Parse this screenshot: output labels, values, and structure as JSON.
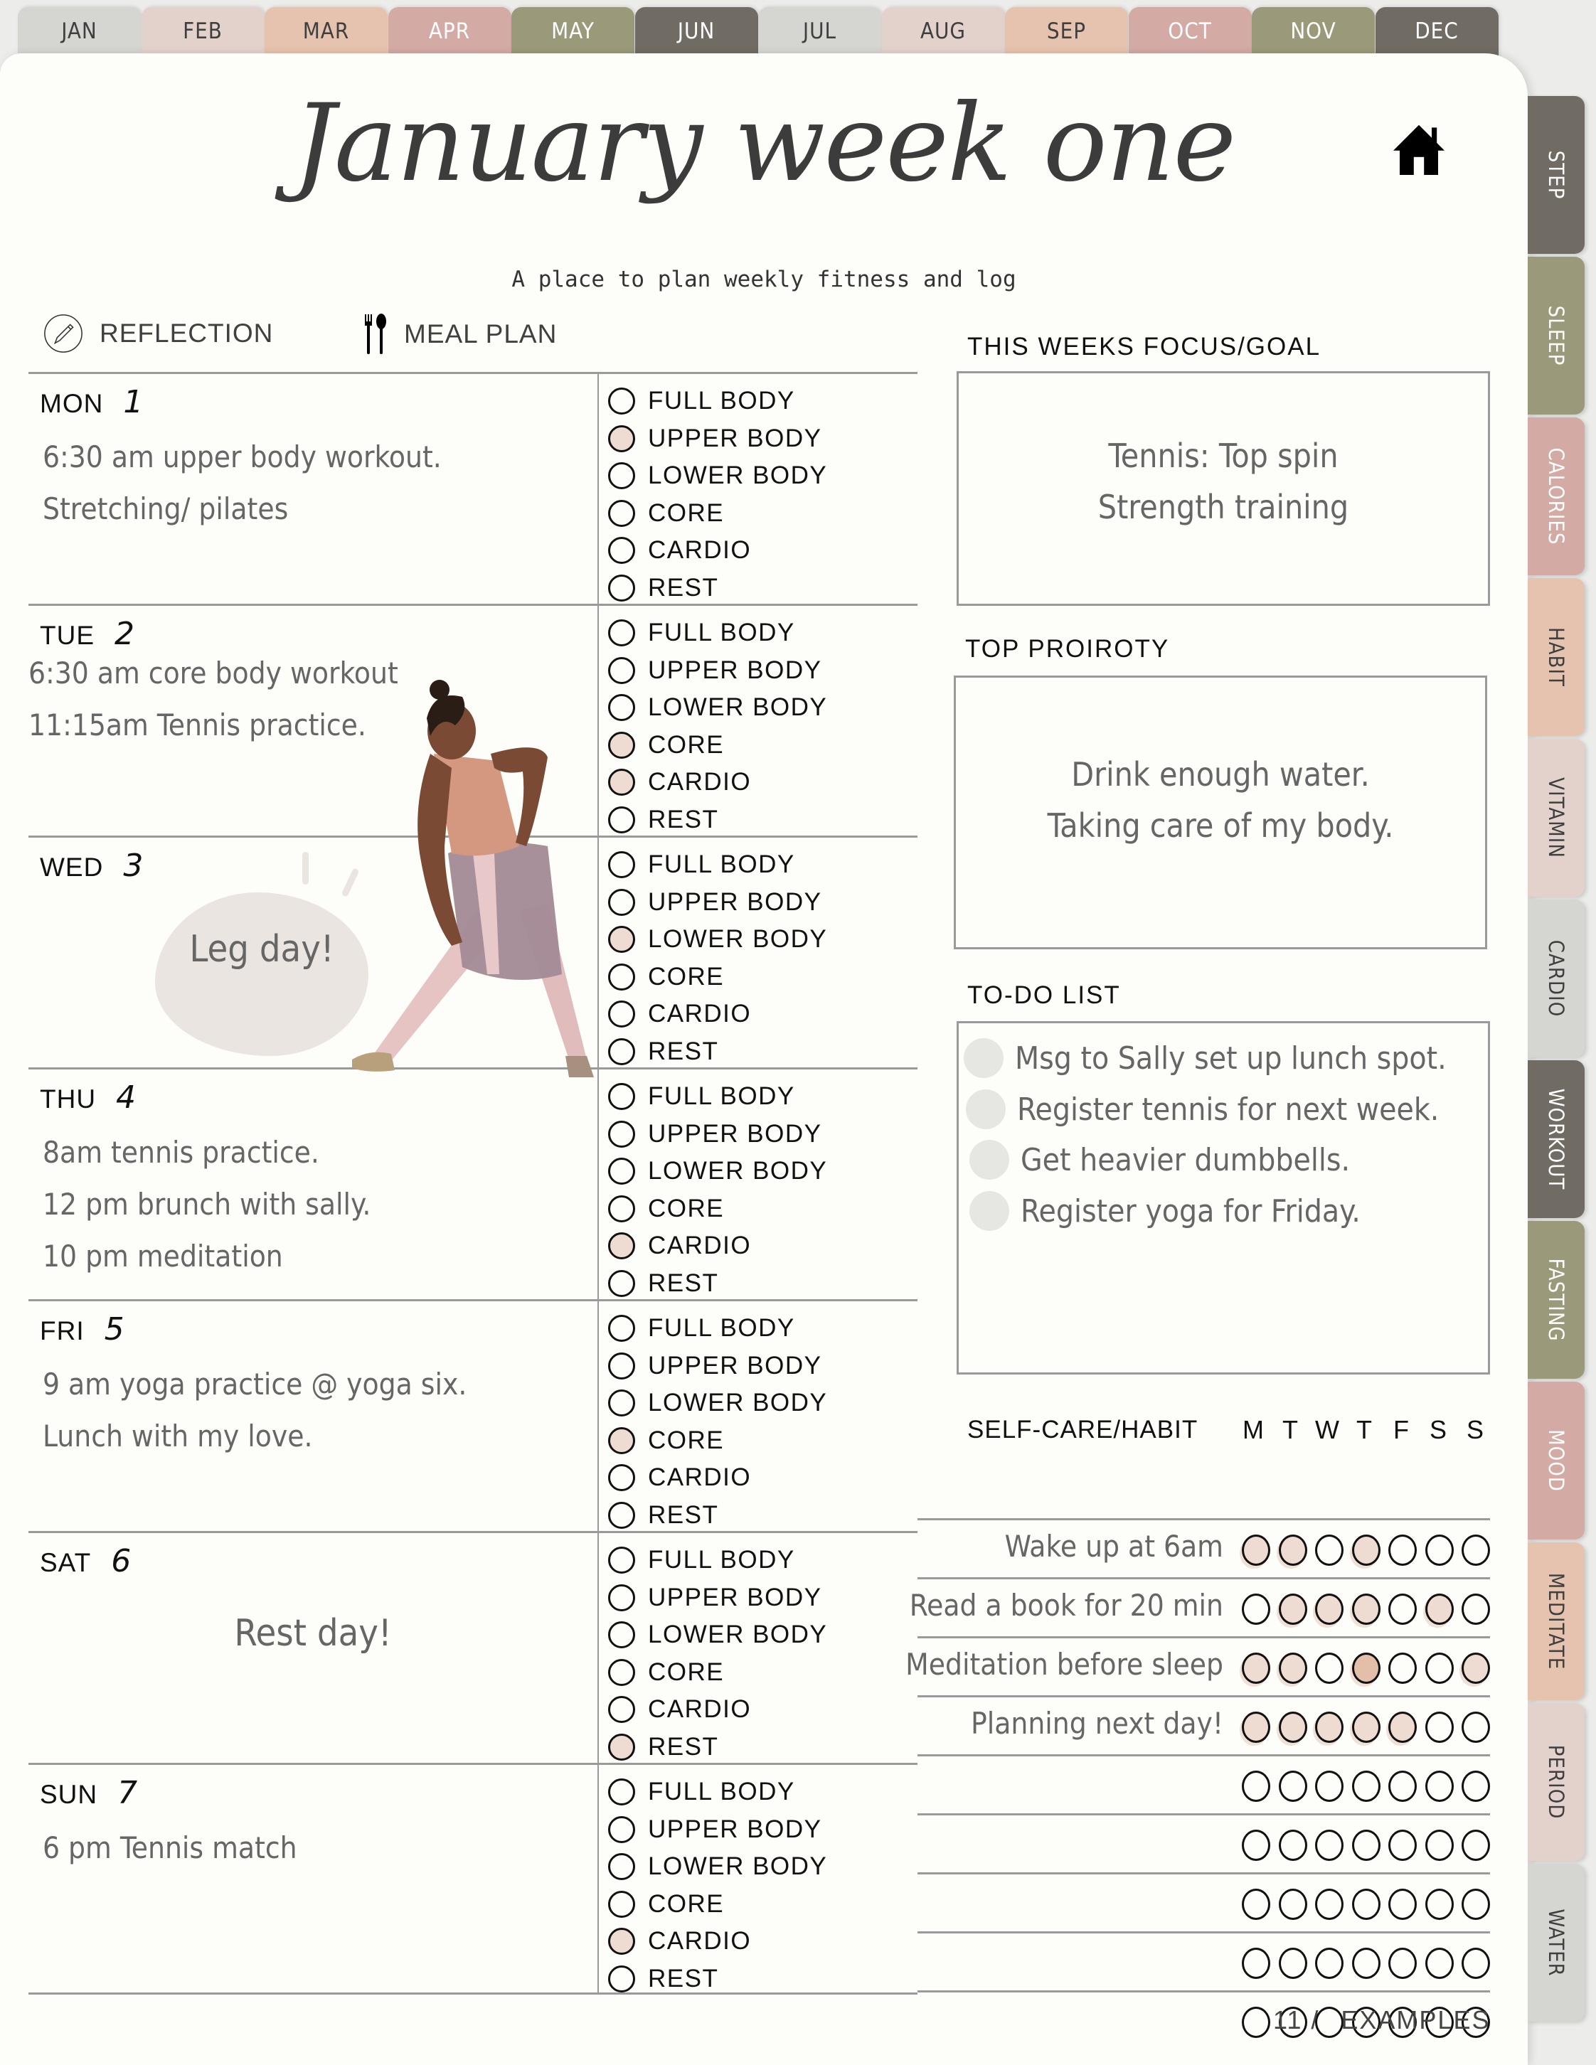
{
  "month_tabs": [
    {
      "label": "JAN",
      "style": "t-grey"
    },
    {
      "label": "FEB",
      "style": "t-blush"
    },
    {
      "label": "MAR",
      "style": "t-peach"
    },
    {
      "label": "APR",
      "style": "t-rose"
    },
    {
      "label": "MAY",
      "style": "t-olive"
    },
    {
      "label": "JUN",
      "style": "t-dark"
    },
    {
      "label": "JUL",
      "style": "t-grey"
    },
    {
      "label": "AUG",
      "style": "t-blush"
    },
    {
      "label": "SEP",
      "style": "t-peach"
    },
    {
      "label": "OCT",
      "style": "t-rose"
    },
    {
      "label": "NOV",
      "style": "t-olive"
    },
    {
      "label": "DEC",
      "style": "t-dark"
    }
  ],
  "side_tabs": [
    {
      "label": "STEP",
      "style": "t-dark"
    },
    {
      "label": "SLEEP",
      "style": "t-olive"
    },
    {
      "label": "CALORIES",
      "style": "t-rose"
    },
    {
      "label": "HABIT",
      "style": "t-peach"
    },
    {
      "label": "VITAMIN",
      "style": "t-blush"
    },
    {
      "label": "CARDIO",
      "style": "t-grey"
    },
    {
      "label": "WORKOUT",
      "style": "t-dark"
    },
    {
      "label": "FASTING",
      "style": "t-olive"
    },
    {
      "label": "MOOD",
      "style": "t-rose"
    },
    {
      "label": "MEDITATE",
      "style": "t-peach"
    },
    {
      "label": "PERIOD",
      "style": "t-blush"
    },
    {
      "label": "WATER",
      "style": "t-grey"
    }
  ],
  "header": {
    "title": "January week one",
    "subtitle": "A place to plan weekly fitness and log",
    "home_icon": "home-icon"
  },
  "quick_links": {
    "reflection": "REFLECTION",
    "meal_plan": "MEAL PLAN"
  },
  "workout_options": [
    "FULL BODY",
    "UPPER BODY",
    "LOWER BODY",
    "CORE",
    "CARDIO",
    "REST"
  ],
  "days": [
    {
      "name": "MON",
      "num": "1",
      "notes": [
        "6:30 am upper body workout.",
        "Stretching/ pilates"
      ],
      "centered": false,
      "checked": [
        "UPPER BODY"
      ]
    },
    {
      "name": "TUE",
      "num": "2",
      "notes": [
        "6:30 am core body workout",
        "11:15am Tennis practice."
      ],
      "centered": false,
      "checked": [
        "CORE",
        "CARDIO"
      ]
    },
    {
      "name": "WED",
      "num": "3",
      "notes": [],
      "centered": false,
      "checked": [
        "LOWER BODY"
      ]
    },
    {
      "name": "THU",
      "num": "4",
      "notes": [
        "8am tennis practice.",
        "12 pm brunch with sally.",
        "10 pm meditation"
      ],
      "centered": false,
      "checked": [
        "CARDIO"
      ]
    },
    {
      "name": "FRI",
      "num": "5",
      "notes": [
        "9 am yoga practice @ yoga six.",
        "Lunch with my love."
      ],
      "centered": false,
      "checked": [
        "CORE"
      ]
    },
    {
      "name": "SAT",
      "num": "6",
      "notes": [
        "Rest day!"
      ],
      "centered": true,
      "checked": [
        "REST"
      ]
    },
    {
      "name": "SUN",
      "num": "7",
      "notes": [
        "6 pm Tennis match"
      ],
      "centered": false,
      "checked": [
        "CARDIO"
      ]
    }
  ],
  "wed_bubble": "Leg day!",
  "focus": {
    "label": "THIS WEEKS FOCUS/GOAL",
    "lines": [
      "Tennis: Top spin",
      "Strength training"
    ]
  },
  "priority": {
    "label": "TOP PROIROTY",
    "lines": [
      "Drink enough water.",
      "Taking care of my body."
    ]
  },
  "todo": {
    "label": "TO-DO LIST",
    "items": [
      "Msg to Sally set up lunch spot.",
      "Register tennis for next week.",
      "Get heavier dumbbells.",
      "Register yoga for Friday."
    ]
  },
  "habits": {
    "label": "SELF-CARE/HABIT",
    "days": [
      "M",
      "T",
      "W",
      "T",
      "F",
      "S",
      "S"
    ],
    "rows": [
      {
        "label": "Wake up at 6am",
        "marks": [
          1,
          1,
          0,
          1,
          0,
          0,
          0
        ]
      },
      {
        "label": "Read a book for 20 min",
        "marks": [
          0,
          1,
          1,
          1,
          0,
          1,
          0
        ]
      },
      {
        "label": "Meditation before sleep",
        "marks": [
          1,
          1,
          0,
          2,
          0,
          0,
          1
        ]
      },
      {
        "label": "Planning next day!",
        "marks": [
          1,
          1,
          1,
          1,
          1,
          0,
          0
        ]
      },
      {
        "label": "",
        "marks": [
          0,
          0,
          0,
          0,
          0,
          0,
          0
        ]
      },
      {
        "label": "",
        "marks": [
          0,
          0,
          0,
          0,
          0,
          0,
          0
        ]
      },
      {
        "label": "",
        "marks": [
          0,
          0,
          0,
          0,
          0,
          0,
          0
        ]
      },
      {
        "label": "",
        "marks": [
          0,
          0,
          0,
          0,
          0,
          0,
          0
        ]
      },
      {
        "label": "",
        "marks": [
          0,
          0,
          0,
          0,
          0,
          0,
          0
        ]
      }
    ]
  },
  "footer": {
    "page": "11 /",
    "section": "EXAMPLES"
  },
  "colors": {
    "page_bg": "#fdfdf9",
    "checked_fill": "#eedbd1",
    "checked_strong": "#e3bfaa",
    "todo_dot": "#e6e6e2",
    "note_text": "#666666",
    "rule": "#9a9a9a"
  }
}
